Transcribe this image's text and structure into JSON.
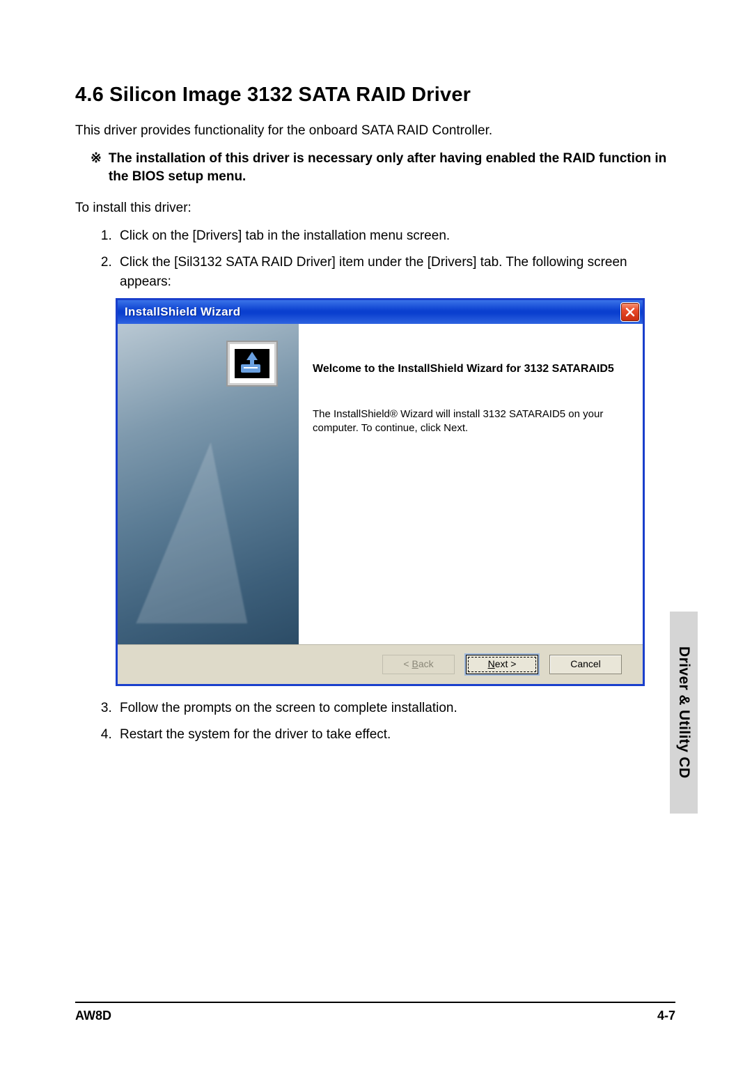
{
  "section": {
    "heading": "4.6 Silicon Image 3132 SATA RAID Driver",
    "intro": "This driver provides functionality for the onboard SATA RAID Controller.",
    "note_symbol": "※",
    "note_text": "The installation of this driver is necessary only after having enabled the RAID function in the BIOS setup menu.",
    "preamble": "To install this driver:",
    "steps": [
      "Click on the [Drivers] tab in the installation menu screen.",
      "Click the [Sil3132 SATA RAID Driver] item under the [Drivers] tab. The following screen appears:",
      "Follow the prompts on the screen to complete installation.",
      "Restart the system for the driver to take effect."
    ]
  },
  "wizard": {
    "title": "InstallShield Wizard",
    "welcome_heading": "Welcome to the InstallShield Wizard for 3132 SATARAID5",
    "welcome_body": "The InstallShield® Wizard will install 3132 SATARAID5 on your computer.  To continue, click Next.",
    "buttons": {
      "back_prefix": "< ",
      "back_ul": "B",
      "back_suffix": "ack",
      "next_ul": "N",
      "next_suffix": "ext >",
      "cancel": "Cancel"
    }
  },
  "side_tab": "Driver & Utility CD",
  "footer": {
    "left": "AW8D",
    "right": "4-7"
  }
}
